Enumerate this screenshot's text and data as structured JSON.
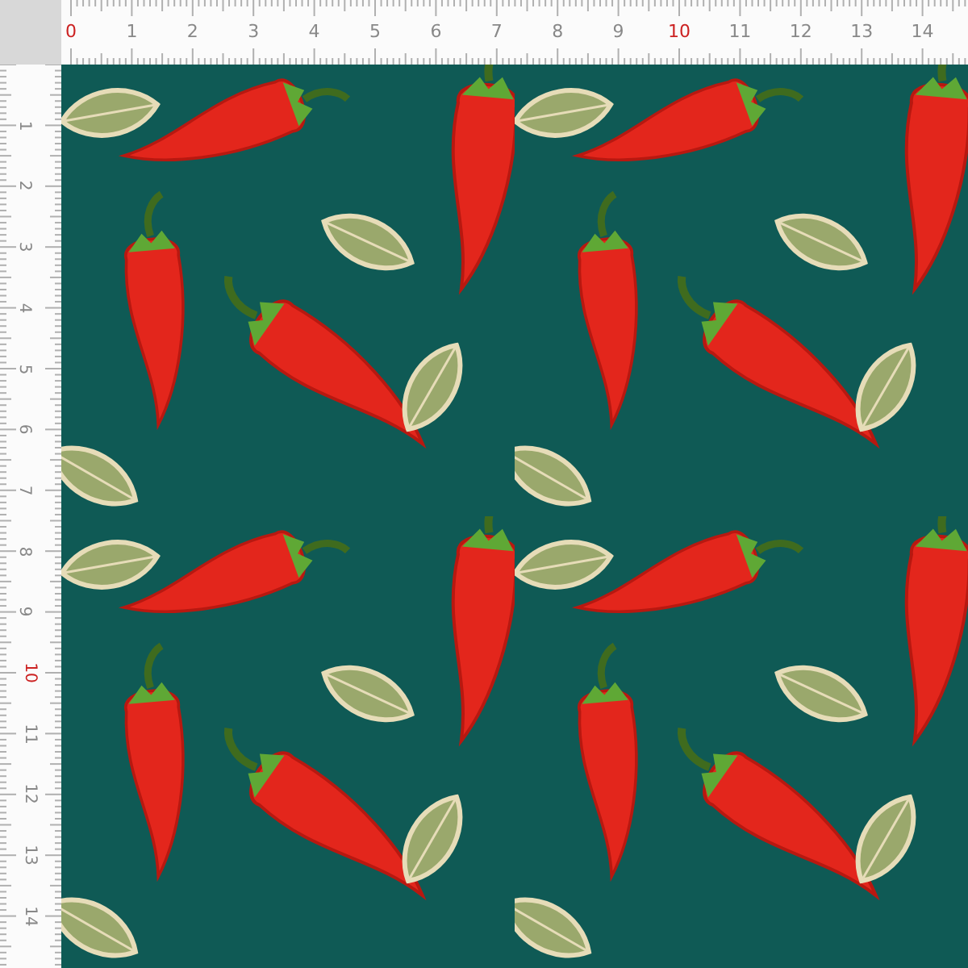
{
  "top_ruler": {
    "labels": [
      {
        "text": "0",
        "color": "#cc2222"
      },
      {
        "text": "1",
        "color": "#888888"
      },
      {
        "text": "2",
        "color": "#888888"
      },
      {
        "text": "3",
        "color": "#888888"
      },
      {
        "text": "4",
        "color": "#888888"
      },
      {
        "text": "5",
        "color": "#888888"
      },
      {
        "text": "6",
        "color": "#888888"
      },
      {
        "text": "7",
        "color": "#888888"
      },
      {
        "text": "8",
        "color": "#888888"
      },
      {
        "text": "9",
        "color": "#888888"
      },
      {
        "text": "10",
        "color": "#cc2222"
      },
      {
        "text": "11",
        "color": "#888888"
      },
      {
        "text": "12",
        "color": "#888888"
      },
      {
        "text": "13",
        "color": "#888888"
      },
      {
        "text": "14",
        "color": "#888888"
      }
    ]
  },
  "left_ruler": {
    "labels": [
      {
        "text": "1",
        "color": "#888888"
      },
      {
        "text": "2",
        "color": "#888888"
      },
      {
        "text": "3",
        "color": "#888888"
      },
      {
        "text": "4",
        "color": "#888888"
      },
      {
        "text": "5",
        "color": "#888888"
      },
      {
        "text": "6",
        "color": "#888888"
      },
      {
        "text": "7",
        "color": "#888888"
      },
      {
        "text": "8",
        "color": "#888888"
      },
      {
        "text": "9",
        "color": "#888888"
      },
      {
        "text": "10",
        "color": "#cc2222"
      },
      {
        "text": "11",
        "color": "#888888"
      },
      {
        "text": "12",
        "color": "#888888"
      },
      {
        "text": "13",
        "color": "#888888"
      },
      {
        "text": "14",
        "color": "#888888"
      }
    ]
  }
}
